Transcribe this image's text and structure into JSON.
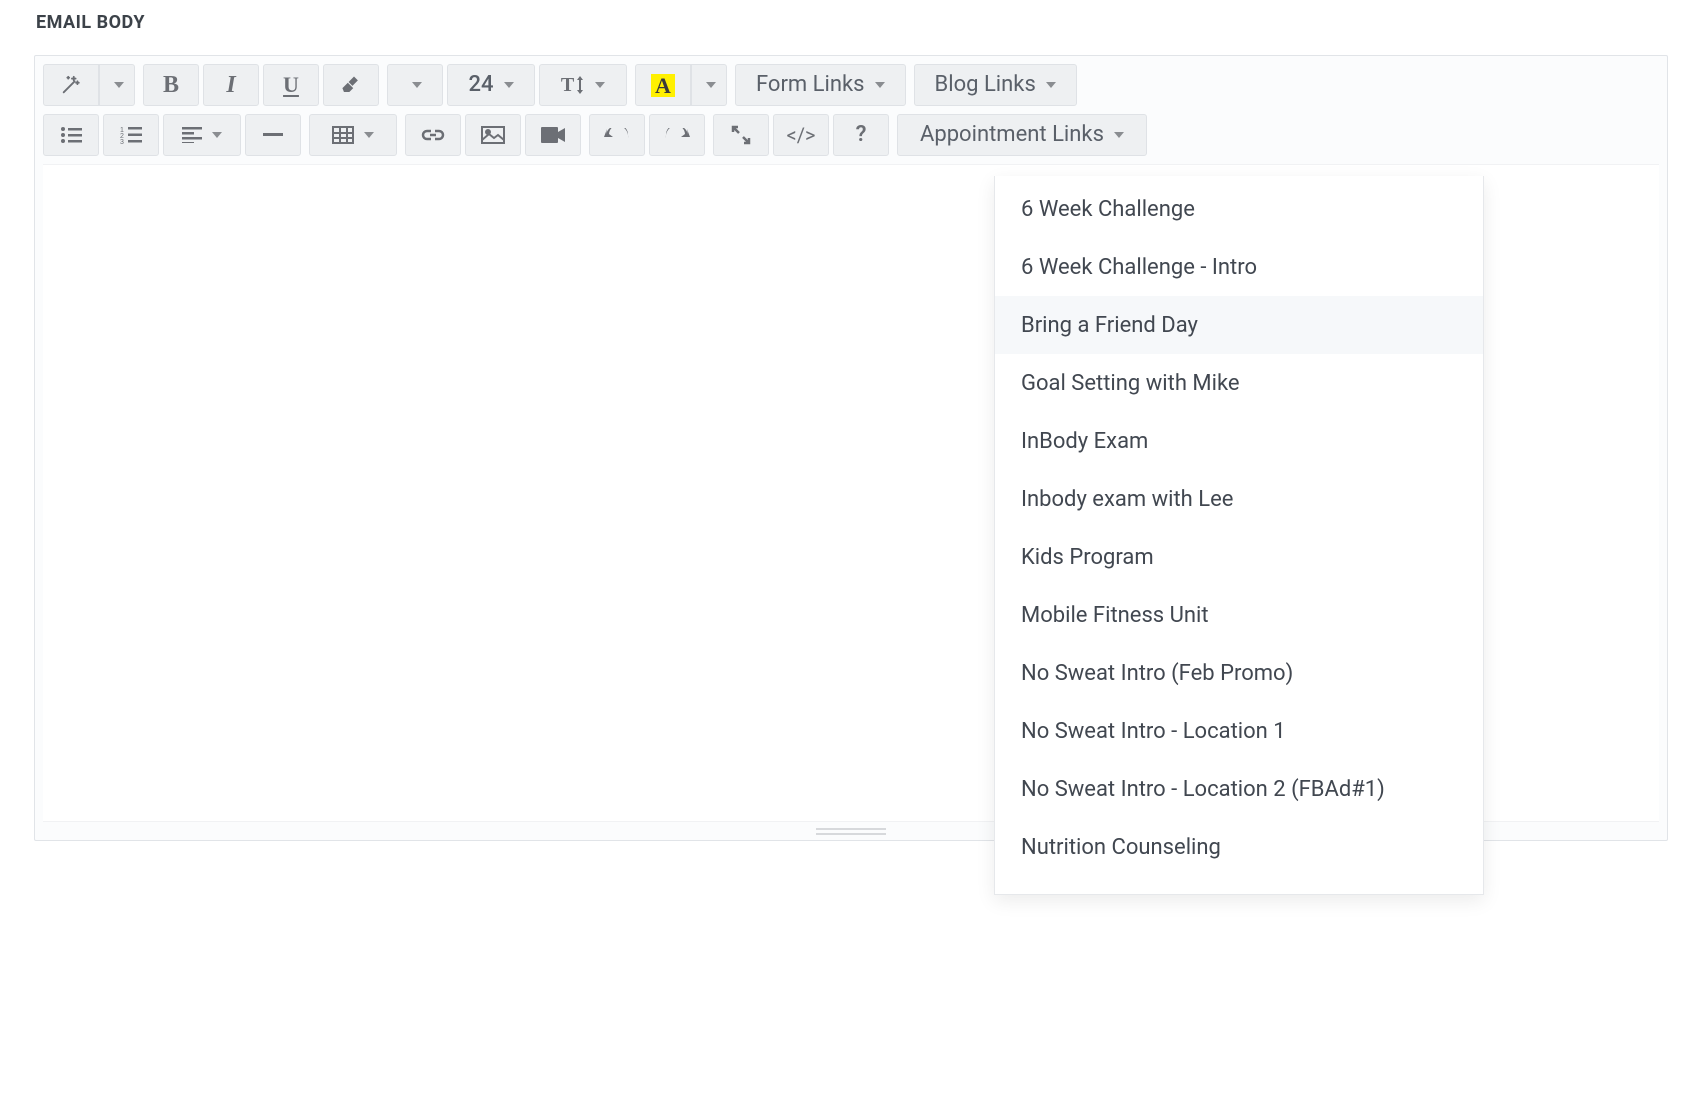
{
  "section_label": "EMAIL BODY",
  "toolbar": {
    "font_size": "24",
    "form_links_label": "Form Links",
    "blog_links_label": "Blog Links",
    "appointment_links_label": "Appointment Links",
    "font_color_glyph": "A",
    "bold_glyph": "B",
    "italic_glyph": "I",
    "underline_glyph": "U",
    "help_glyph": "?",
    "codeview_glyph": "</>",
    "lineheight_glyph": "T↕"
  },
  "appointment_links": {
    "items": [
      "6 Week Challenge",
      "6 Week Challenge - Intro",
      "Bring a Friend Day",
      "Goal Setting with Mike",
      "InBody Exam",
      "Inbody exam with Lee",
      "Kids Program",
      "Mobile Fitness Unit",
      "No Sweat Intro (Feb Promo)",
      "No Sweat Intro - Location 1",
      "No Sweat Intro - Location 2 (FBAd#1)",
      "Nutrition Counseling"
    ],
    "hovered_index": 2
  }
}
